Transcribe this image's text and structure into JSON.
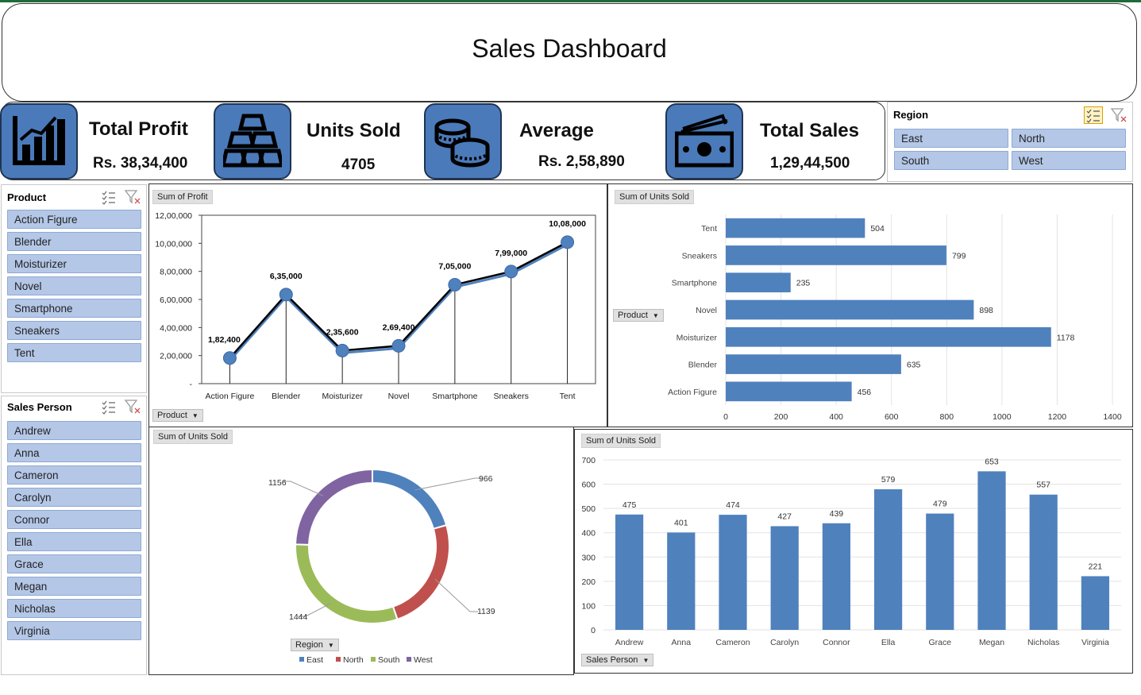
{
  "title": "Sales Dashboard",
  "kpis": [
    {
      "title": "Total Profit",
      "value": "Rs. 38,34,400",
      "icon": "bar-chart-icon"
    },
    {
      "title": "Units Sold",
      "value": "4705",
      "icon": "gold-bars-icon"
    },
    {
      "title": "Average",
      "value": "Rs. 2,58,890",
      "icon": "coins-icon"
    },
    {
      "title": "Total Sales",
      "value": "1,29,44,500",
      "icon": "cash-icon"
    }
  ],
  "region_slicer": {
    "title": "Region",
    "items": [
      "East",
      "North",
      "South",
      "West"
    ]
  },
  "product_slicer": {
    "title": "Product",
    "items": [
      "Action Figure",
      "Blender",
      "Moisturizer",
      "Novel",
      "Smartphone",
      "Sneakers",
      "Tent"
    ]
  },
  "salesperson_slicer": {
    "title": "Sales Person",
    "items": [
      "Andrew",
      "Anna",
      "Cameron",
      "Carolyn",
      "Connor",
      "Ella",
      "Grace",
      "Megan",
      "Nicholas",
      "Virginia"
    ]
  },
  "charts": {
    "profit_line": {
      "tag": "Sum of Profit",
      "field": "Product"
    },
    "units_bar": {
      "tag": "Sum of Units Sold",
      "field": "Product"
    },
    "region_donut": {
      "tag": "Sum of Units Sold",
      "field": "Region"
    },
    "person_col": {
      "tag": "Sum of Units Sold",
      "field": "Sales Person"
    }
  },
  "colors": {
    "accent": "#4a7ab9",
    "slicer_item": "#b4c7e7",
    "bar": "#4f81bd"
  },
  "chart_data": [
    {
      "id": "profit_line",
      "type": "line",
      "categories": [
        "Action Figure",
        "Blender",
        "Moisturizer",
        "Novel",
        "Smartphone",
        "Sneakers",
        "Tent"
      ],
      "values": [
        182400,
        635000,
        235600,
        269400,
        705000,
        799000,
        1008000
      ],
      "data_labels": [
        "1,82,400",
        "6,35,000",
        "2,35,600",
        "2,69,400",
        "7,05,000",
        "7,99,000",
        "10,08,000"
      ],
      "ylim": [
        0,
        1200000
      ],
      "yticks": [
        0,
        200000,
        400000,
        600000,
        800000,
        1000000,
        1200000
      ],
      "ytick_labels": [
        "-",
        "2,00,000",
        "4,00,000",
        "6,00,000",
        "8,00,000",
        "10,00,000",
        "12,00,000"
      ]
    },
    {
      "id": "units_bar",
      "type": "bar",
      "orientation": "horizontal",
      "categories": [
        "Tent",
        "Sneakers",
        "Smartphone",
        "Novel",
        "Moisturizer",
        "Blender",
        "Action Figure"
      ],
      "values": [
        504,
        799,
        235,
        898,
        1178,
        635,
        456
      ],
      "xlim": [
        0,
        1400
      ],
      "xticks": [
        0,
        200,
        400,
        600,
        800,
        1000,
        1200,
        1400
      ]
    },
    {
      "id": "region_donut",
      "type": "pie",
      "categories": [
        "East",
        "North",
        "South",
        "West"
      ],
      "values": [
        966,
        1139,
        1444,
        1156
      ],
      "colors": [
        "#4f81bd",
        "#c0504d",
        "#9bbb59",
        "#8064a2"
      ],
      "legend": "bottom"
    },
    {
      "id": "person_col",
      "type": "bar",
      "categories": [
        "Andrew",
        "Anna",
        "Cameron",
        "Carolyn",
        "Connor",
        "Ella",
        "Grace",
        "Megan",
        "Nicholas",
        "Virginia"
      ],
      "values": [
        475,
        401,
        474,
        427,
        439,
        579,
        479,
        653,
        557,
        221
      ],
      "ylim": [
        0,
        700
      ],
      "yticks": [
        0,
        100,
        200,
        300,
        400,
        500,
        600,
        700
      ]
    }
  ]
}
